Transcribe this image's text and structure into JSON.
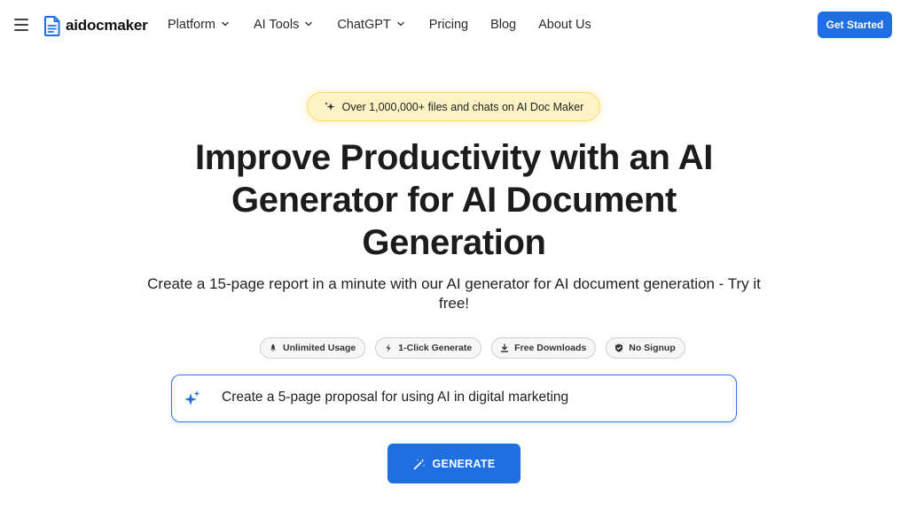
{
  "nav": {
    "logo_text": "aidocmaker",
    "menu": [
      {
        "label": "Platform",
        "dropdown": true
      },
      {
        "label": "AI Tools",
        "dropdown": true
      },
      {
        "label": "ChatGPT",
        "dropdown": true
      },
      {
        "label": "Pricing",
        "dropdown": false
      },
      {
        "label": "Blog",
        "dropdown": false
      },
      {
        "label": "About Us",
        "dropdown": false
      }
    ],
    "cta_label": "Get Started"
  },
  "hero": {
    "badge_text": "Over 1,000,000+ files and chats on AI Doc Maker",
    "headline": "Improve Productivity with an AI Generator for AI Document Generation",
    "subheadline": "Create a 15-page report in a minute with our AI generator for AI document generation - Try it free!",
    "features": [
      {
        "label": "Unlimited Usage",
        "icon": "rocket-icon"
      },
      {
        "label": "1-Click Generate",
        "icon": "lightning-icon"
      },
      {
        "label": "Free Downloads",
        "icon": "download-icon"
      },
      {
        "label": "No Signup",
        "icon": "shield-check-icon"
      }
    ],
    "prompt_text": "Create a 5-page proposal for using AI in digital marketing",
    "generate_label": "GENERATE"
  },
  "colors": {
    "primary": "#1f6fe0",
    "badge_bg": "#fdf3c4",
    "badge_border": "#f6dc6a"
  }
}
